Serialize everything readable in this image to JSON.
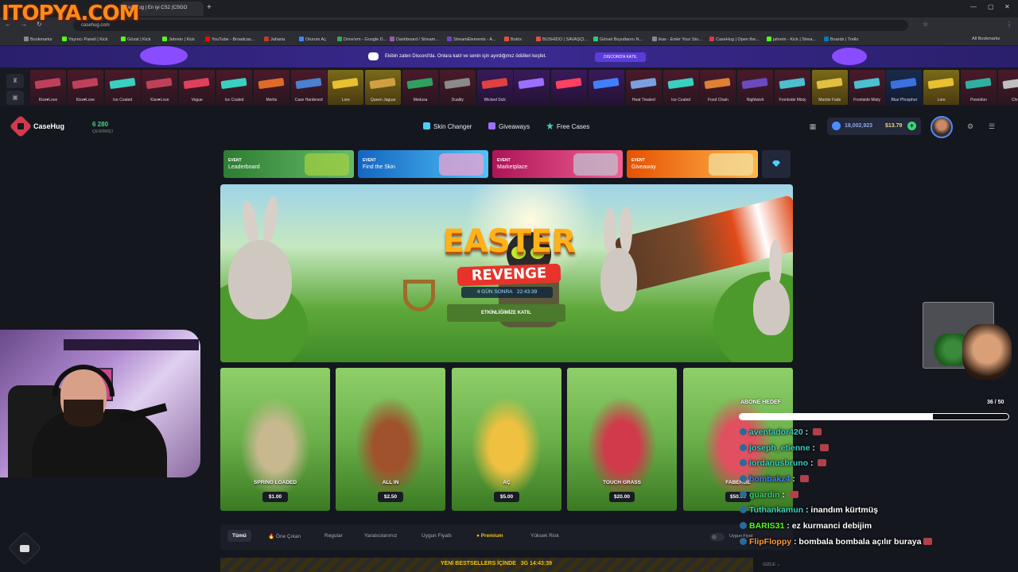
{
  "browser": {
    "tab_title": "CaseHug | En iyi CS2 (CSGO",
    "url": "casehug.com",
    "bookmarks": [
      {
        "label": "Bookmarks",
        "color": "#888888"
      },
      {
        "label": "Yayıncı Paneli | Kick",
        "color": "#53fc18"
      },
      {
        "label": "Gözat | Kick",
        "color": "#53fc18"
      },
      {
        "label": "Jahrein | Kick",
        "color": "#53fc18"
      },
      {
        "label": "YouTube - Broadcas...",
        "color": "#ff0000"
      },
      {
        "label": "Jaharia",
        "color": "#c0392b"
      },
      {
        "label": "Oturum Aç",
        "color": "#4285f4"
      },
      {
        "label": "Drive'em - Google D...",
        "color": "#34a853"
      },
      {
        "label": "Dashboard / Stream...",
        "color": "#9b59b6"
      },
      {
        "label": "StreamElements - A...",
        "color": "#6f42c1"
      },
      {
        "label": "Botrix",
        "color": "#e74c3c"
      },
      {
        "label": "BUSHIDO | SAVAŞÇI...",
        "color": "#e74c3c"
      },
      {
        "label": "Görsel Boyutlarını N...",
        "color": "#2ecc71"
      },
      {
        "label": "ikas - Enter Your Sto...",
        "color": "#7f8c8d"
      },
      {
        "label": "CaseHug | Open the...",
        "color": "#d33a4f"
      },
      {
        "label": "jahrein - Kick | Strea...",
        "color": "#53fc18"
      },
      {
        "label": "Boards | Trello",
        "color": "#0079bf"
      }
    ],
    "all_bookmarks": "All Bookmarks"
  },
  "overlay_logo": "ITOPYA.COM",
  "discord_banner": {
    "text": "Ekibin zaten Discord'da. Onlara katıl ve senin için ayırdığımız ödülleri keşfet.",
    "button": "DISCORD'A KATIL"
  },
  "live_drops": [
    {
      "label": "Kiss♥Love",
      "color": "#c0405a",
      "style": ""
    },
    {
      "label": "Kiss♥Love",
      "color": "#c0405a",
      "style": ""
    },
    {
      "label": "Ice Coaled",
      "color": "#3ad0c0",
      "style": ""
    },
    {
      "label": "Kiss♥Love",
      "color": "#c0405a",
      "style": ""
    },
    {
      "label": "Vogue",
      "color": "#e0405a",
      "style": ""
    },
    {
      "label": "Ice Coaled",
      "color": "#3ad0c0",
      "style": ""
    },
    {
      "label": "Mortis",
      "color": "#e06a2a",
      "style": ""
    },
    {
      "label": "Case Hardened",
      "color": "#4a80d0",
      "style": ""
    },
    {
      "label": "Lore",
      "color": "#e8c030",
      "style": "gold"
    },
    {
      "label": "Queen Jaguar",
      "color": "#d0a040",
      "style": "gold"
    },
    {
      "label": "Medusa",
      "color": "#30a060",
      "style": ""
    },
    {
      "label": "Duality",
      "color": "#8a8a8a",
      "style": ""
    },
    {
      "label": "Wicked Sick",
      "color": "#e04040",
      "style": "purple"
    },
    {
      "label": "",
      "color": "#9a70ff",
      "style": "purple"
    },
    {
      "label": "",
      "color": "#ff4060",
      "style": "purple"
    },
    {
      "label": "",
      "color": "#4080ff",
      "style": "purple"
    },
    {
      "label": "Heat Treated",
      "color": "#7aa0e0",
      "style": ""
    },
    {
      "label": "Ice Coaled",
      "color": "#3ad0c0",
      "style": ""
    },
    {
      "label": "Food Chain",
      "color": "#e08030",
      "style": ""
    },
    {
      "label": "Nightwish",
      "color": "#6a4ac0",
      "style": ""
    },
    {
      "label": "Frontside Misty",
      "color": "#4ac0d0",
      "style": ""
    },
    {
      "label": "Marble Fade",
      "color": "#e0c040",
      "style": "gold"
    },
    {
      "label": "Frontside Misty",
      "color": "#4ac0d0",
      "style": ""
    },
    {
      "label": "Blue Phosphor",
      "color": "#3a70e0",
      "style": "blue"
    },
    {
      "label": "Lore",
      "color": "#e8c030",
      "style": "gold"
    },
    {
      "label": "Poseidon",
      "color": "#30b0a0",
      "style": ""
    },
    {
      "label": "Chro",
      "color": "#c0c0c0",
      "style": ""
    }
  ],
  "header": {
    "brand": "CaseHug",
    "online_count": "6 280",
    "online_label": "ÇEVRİMİÇİ",
    "nav": [
      {
        "label": "Skin Changer",
        "icon": "swap-icon",
        "color": "#4ad0ff"
      },
      {
        "label": "Giveaways",
        "icon": "gift-icon",
        "color": "#9a70ff"
      },
      {
        "label": "Free Cases",
        "icon": "star-icon",
        "color": "#3ad0c0"
      }
    ],
    "balance_coins": "18,002,923",
    "balance_usd": "$13.79"
  },
  "events": [
    {
      "tag": "EVENT",
      "name": "Leaderboard",
      "color1": "#2e7d32",
      "color2": "#66bb6a"
    },
    {
      "tag": "EVENT",
      "name": "Find the Skin",
      "color1": "#1565c0",
      "color2": "#4fc3f7"
    },
    {
      "tag": "EVENT",
      "name": "Marketplace",
      "color1": "#ad1457",
      "color2": "#f06292"
    },
    {
      "tag": "EVENT",
      "name": "Giveaway",
      "color1": "#e65100",
      "color2": "#ffb74d"
    }
  ],
  "hero": {
    "title_line1": "EASTER",
    "title_line2": "REVENGE",
    "countdown_days": "4 GÜN SONRA",
    "countdown_time": "22:43:39",
    "cta": "ETKİNLİĞİMİZE KATIL"
  },
  "cases": [
    {
      "name": "SPRING LOADED",
      "price": "$1.00",
      "accent": "#c8b890"
    },
    {
      "name": "ALL IN",
      "price": "$2.50",
      "accent": "#a0522d"
    },
    {
      "name": "AÇ",
      "price": "$5.00",
      "accent": "#f0c040"
    },
    {
      "name": "TOUCH GRASS",
      "price": "$20.00",
      "accent": "#d03a4a"
    },
    {
      "name": "FABERGÉ",
      "price": "$50.00",
      "accent": "#e05060"
    }
  ],
  "filters": [
    {
      "label": "Tümü",
      "active": true
    },
    {
      "label": "Öne Çıkan",
      "active": false
    },
    {
      "label": "Regular",
      "active": false
    },
    {
      "label": "Yaratıcılarımız",
      "active": false
    },
    {
      "label": "Uygun Fiyatlı",
      "active": false
    },
    {
      "label": "Premium",
      "active": false
    },
    {
      "label": "Yüksek Risk",
      "active": false
    }
  ],
  "filter_toggle_label": "Uygun Fiyat",
  "bestsellers": {
    "text": "YENİ BESTSELLERS İÇİNDE",
    "time": "3G 14:43:39",
    "hide": "GİZLE"
  },
  "stream_overlay": {
    "sub_goal_label": "ABONE HEDEF",
    "sub_current": 36,
    "sub_target": 50,
    "sub_display": "36 / 50",
    "chat": [
      {
        "user": "aventador420",
        "msg": "",
        "color": "#3ad0c0",
        "emote": true
      },
      {
        "user": "joseph_etienne",
        "msg": "",
        "color": "#3ad0c0",
        "emote": true
      },
      {
        "user": "iordanusbruno",
        "msg": "",
        "color": "#3ad0c0",
        "emote": true
      },
      {
        "user": "bombakz4",
        "msg": "",
        "color": "#4a80ff",
        "emote": true
      },
      {
        "user": "guardin",
        "msg": "",
        "color": "#3ad07a",
        "emote": true
      },
      {
        "user": "Tuthankamun",
        "msg": "inandım kürtmüş",
        "color": "#3ad0c0",
        "emote": false
      },
      {
        "user": "BARIS31",
        "msg": "ez kurmanci debijim",
        "color": "#53fc18",
        "emote": false
      },
      {
        "user": "FlipFloppy",
        "msg": "bombala bombala açılır buraya",
        "color": "#ff9a3a",
        "emote": true
      }
    ]
  }
}
